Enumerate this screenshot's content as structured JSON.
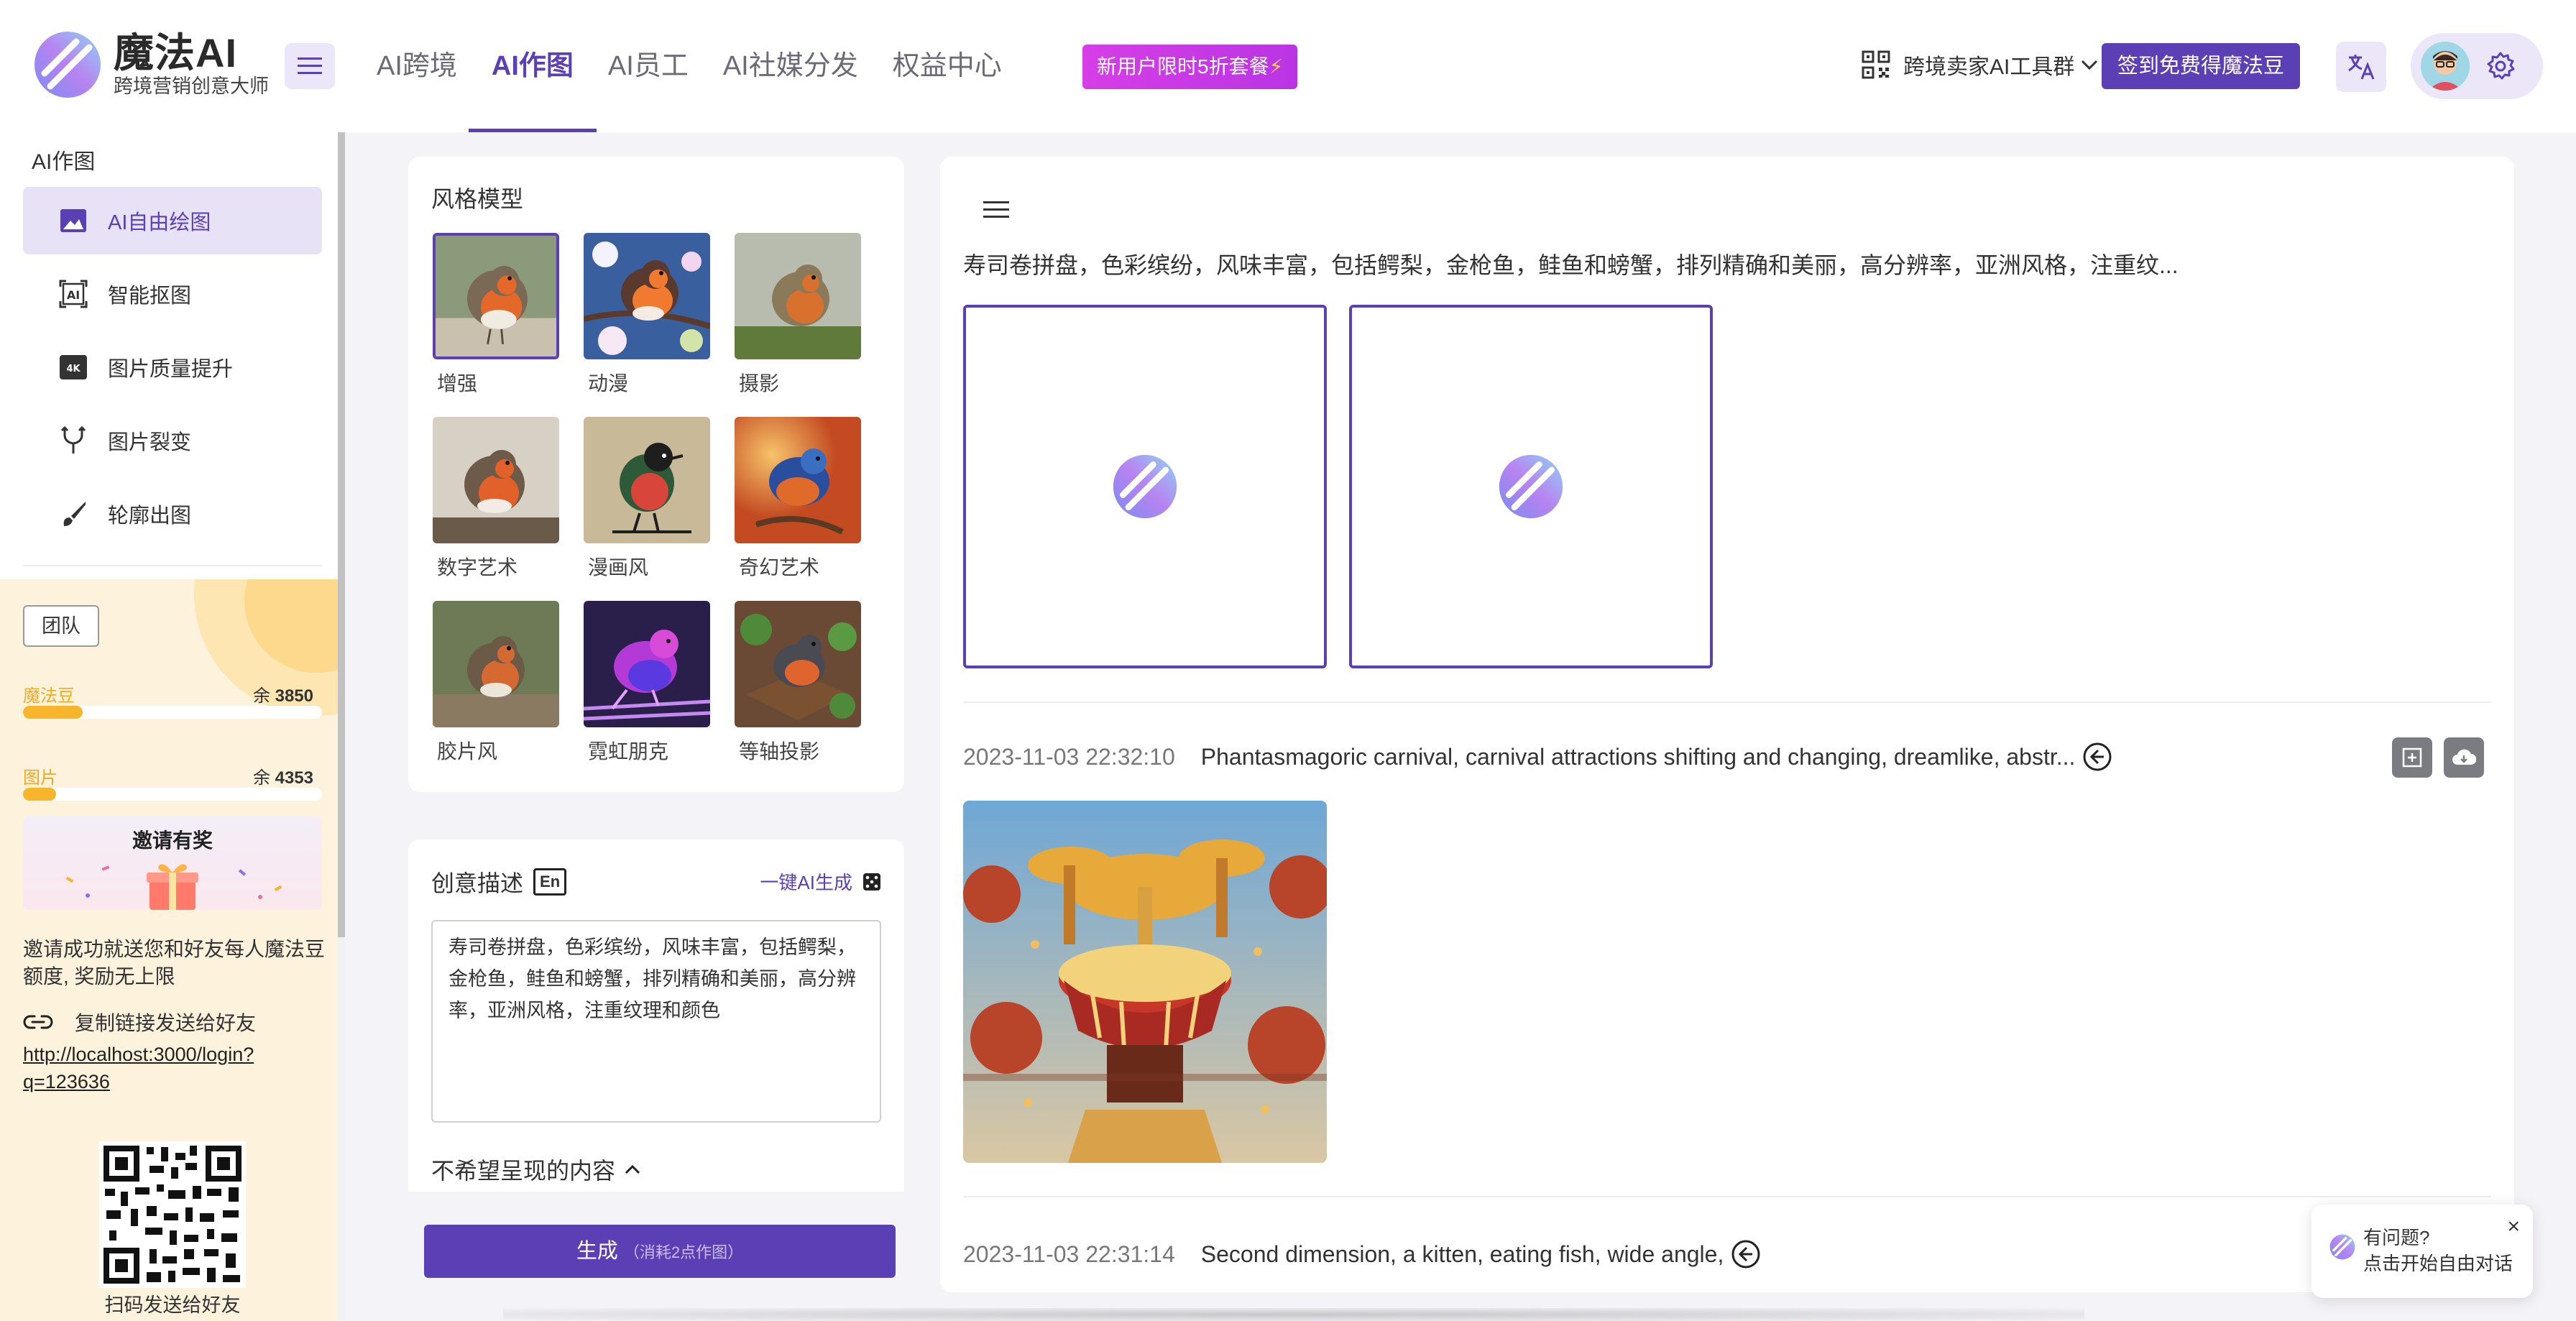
{
  "header": {
    "logo_title": "魔法AI",
    "logo_subtitle": "跨境营销创意大师",
    "nav": [
      {
        "label": "AI跨境"
      },
      {
        "label": "AI作图"
      },
      {
        "label": "AI员工"
      },
      {
        "label": "AI社媒分发"
      },
      {
        "label": "权益中心"
      }
    ],
    "active_nav": "AI作图",
    "promo_label": "新用户限时5折套餐",
    "promo_icon": "lightning-icon",
    "group_link": "跨境卖家AI工具群",
    "signin_label": "签到免费得魔法豆",
    "accent_color": "#5b3fb5"
  },
  "sidebar": {
    "title": "AI作图",
    "items": [
      {
        "label": "AI自由绘图",
        "icon": "image-icon",
        "active": true
      },
      {
        "label": "智能抠图",
        "icon": "ai-crop-icon"
      },
      {
        "label": "图片质量提升",
        "icon": "4k-icon"
      },
      {
        "label": "图片裂变",
        "icon": "fork-icon"
      },
      {
        "label": "轮廓出图",
        "icon": "brush-icon"
      }
    ],
    "team_label": "团队",
    "credits": [
      {
        "label": "魔法豆",
        "remain_prefix": "余",
        "remain": "3850",
        "level": 0.2
      },
      {
        "label": "图片",
        "remain_prefix": "余",
        "remain": "4353",
        "level": 0.11
      }
    ],
    "invite_title": "邀请有奖",
    "invite_text": "邀请成功就送您和好友每人魔法豆额度, 奖励无上限",
    "copy_link_label": "复制链接发送给好友",
    "invite_url": "http://localhost:3000/login?q=123636",
    "qr_caption": "扫码发送给好友"
  },
  "style_panel": {
    "title": "风格模型",
    "styles": [
      {
        "label": "增强",
        "selected": true
      },
      {
        "label": "动漫"
      },
      {
        "label": "摄影"
      },
      {
        "label": "数字艺术"
      },
      {
        "label": "漫画风"
      },
      {
        "label": "奇幻艺术"
      },
      {
        "label": "胶片风"
      },
      {
        "label": "霓虹朋克"
      },
      {
        "label": "等轴投影"
      }
    ]
  },
  "description": {
    "title": "创意描述",
    "en_badge": "En",
    "ai_generate": "一键AI生成",
    "prompt": "寿司卷拼盘，色彩缤纷，风味丰富，包括鳄梨，金枪鱼，鲑鱼和螃蟹，排列精确和美丽，高分辨率，亚洲风格，注重纹理和颜色",
    "negative_title": "不希望呈现的内容"
  },
  "generate_button": {
    "label": "生成",
    "cost": "（消耗2点作图）"
  },
  "results": {
    "current_prompt": "寿司卷拼盘，色彩缤纷，风味丰富，包括鳄梨，金枪鱼，鲑鱼和螃蟹，排列精确和美丽，高分辨率，亚洲风格，注重纹...",
    "history": [
      {
        "time": "2023-11-03 22:32:10",
        "prompt": "Phantasmagoric carnival, carnival attractions shifting and changing, dreamlike, abstr..."
      },
      {
        "time": "2023-11-03 22:31:14",
        "prompt": "Second dimension, a kitten, eating fish, wide angle,"
      }
    ]
  },
  "help": {
    "question": "有问题?",
    "sub": "点击开始自由对话",
    "close": "×"
  }
}
